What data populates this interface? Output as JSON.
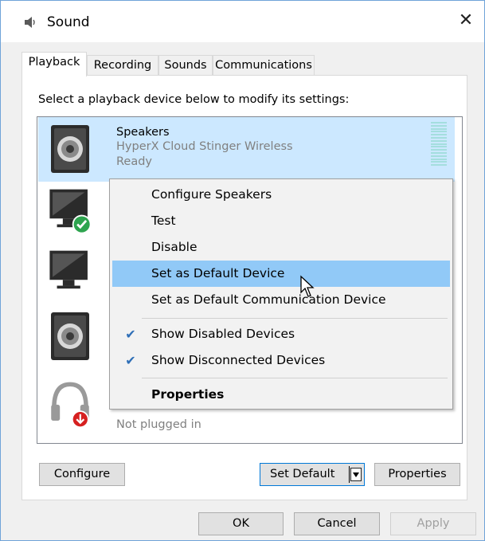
{
  "window": {
    "title": "Sound",
    "close_glyph": "✕"
  },
  "tabs": [
    {
      "label": "Playback",
      "active": true
    },
    {
      "label": "Recording",
      "active": false
    },
    {
      "label": "Sounds",
      "active": false
    },
    {
      "label": "Communications",
      "active": false
    }
  ],
  "playback": {
    "instruction": "Select a playback device below to modify its settings:",
    "devices": [
      {
        "name": "Speakers",
        "description": "HyperX Cloud Stinger Wireless",
        "status": "Ready",
        "icon": "speaker-icon",
        "selected": true
      },
      {
        "name": "",
        "description": "",
        "status": "",
        "icon": "monitor-default-icon",
        "selected": false
      },
      {
        "name": "",
        "description": "",
        "status": "",
        "icon": "monitor-icon",
        "selected": false
      },
      {
        "name": "",
        "description": "",
        "status": "",
        "icon": "speaker-icon",
        "selected": false
      },
      {
        "name": "",
        "description": "",
        "status": "Not plugged in",
        "icon": "headphones-unplugged-icon",
        "selected": false
      }
    ]
  },
  "context_menu": {
    "items": [
      {
        "label": "Configure Speakers",
        "checked": false,
        "highlighted": false
      },
      {
        "label": "Test",
        "checked": false,
        "highlighted": false
      },
      {
        "label": "Disable",
        "checked": false,
        "highlighted": false
      },
      {
        "label": "Set as Default Device",
        "checked": false,
        "highlighted": true
      },
      {
        "label": "Set as Default Communication Device",
        "checked": false,
        "highlighted": false
      },
      {
        "label": "Show Disabled Devices",
        "checked": true,
        "highlighted": false
      },
      {
        "label": "Show Disconnected Devices",
        "checked": true,
        "highlighted": false
      },
      {
        "label": "Properties",
        "checked": false,
        "highlighted": false,
        "bold": true
      }
    ],
    "check_glyph": "✔"
  },
  "buttons": {
    "configure": "Configure",
    "set_default": "Set Default",
    "properties": "Properties",
    "ok": "OK",
    "cancel": "Cancel",
    "apply": "Apply"
  },
  "colors": {
    "selection": "#cce8ff",
    "menu_highlight": "#91c9f7",
    "check": "#2f6fb7",
    "default_badge": "#2ea44f",
    "unplugged_badge": "#d62020"
  }
}
